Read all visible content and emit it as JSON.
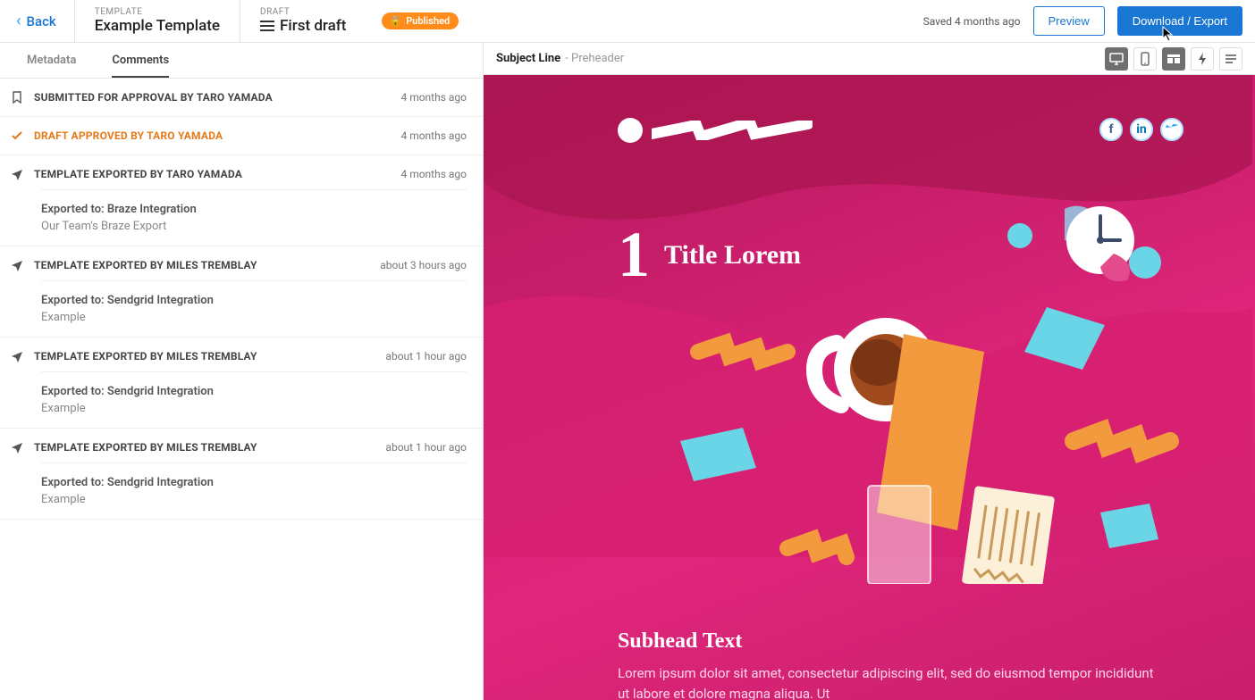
{
  "header": {
    "back": "Back",
    "template_label": "TEMPLATE",
    "template_name": "Example Template",
    "draft_label": "DRAFT",
    "draft_name": "First draft",
    "published_badge": "Published",
    "saved": "Saved 4 months ago",
    "preview_btn": "Preview",
    "export_btn": "Download / Export"
  },
  "tabs": {
    "metadata": "Metadata",
    "comments": "Comments"
  },
  "events": [
    {
      "icon": "bookmark",
      "title": "SUBMITTED FOR APPROVAL BY TARO YAMADA",
      "time": "4 months ago"
    },
    {
      "icon": "check",
      "title": "DRAFT APPROVED BY TARO YAMADA",
      "time": "4 months ago",
      "orange": true
    },
    {
      "icon": "plane",
      "title": "TEMPLATE EXPORTED BY TARO YAMADA",
      "time": "4 months ago",
      "detail1": "Exported to: Braze Integration",
      "detail2": "Our Team's Braze Export"
    },
    {
      "icon": "plane",
      "title": "TEMPLATE EXPORTED BY MILES TREMBLAY",
      "time": "about 3 hours ago",
      "detail1": "Exported to: Sendgrid Integration",
      "detail2": "Example"
    },
    {
      "icon": "plane",
      "title": "TEMPLATE EXPORTED BY MILES TREMBLAY",
      "time": "about 1 hour ago",
      "detail1": "Exported to: Sendgrid Integration",
      "detail2": "Example"
    },
    {
      "icon": "plane",
      "title": "TEMPLATE EXPORTED BY MILES TREMBLAY",
      "time": "about 1 hour ago",
      "detail1": "Exported to: Sendgrid Integration",
      "detail2": "Example"
    }
  ],
  "subject": {
    "label": "Subject Line",
    "pre": "- Preheader"
  },
  "email": {
    "hero_num": "1",
    "hero_title": "Title Lorem",
    "subhead": "Subhead Text",
    "body": "Lorem ipsum dolor sit amet, consectetur adipiscing elit, sed do eiusmod tempor incididunt ut labore et dolore magna aliqua. Ut"
  }
}
